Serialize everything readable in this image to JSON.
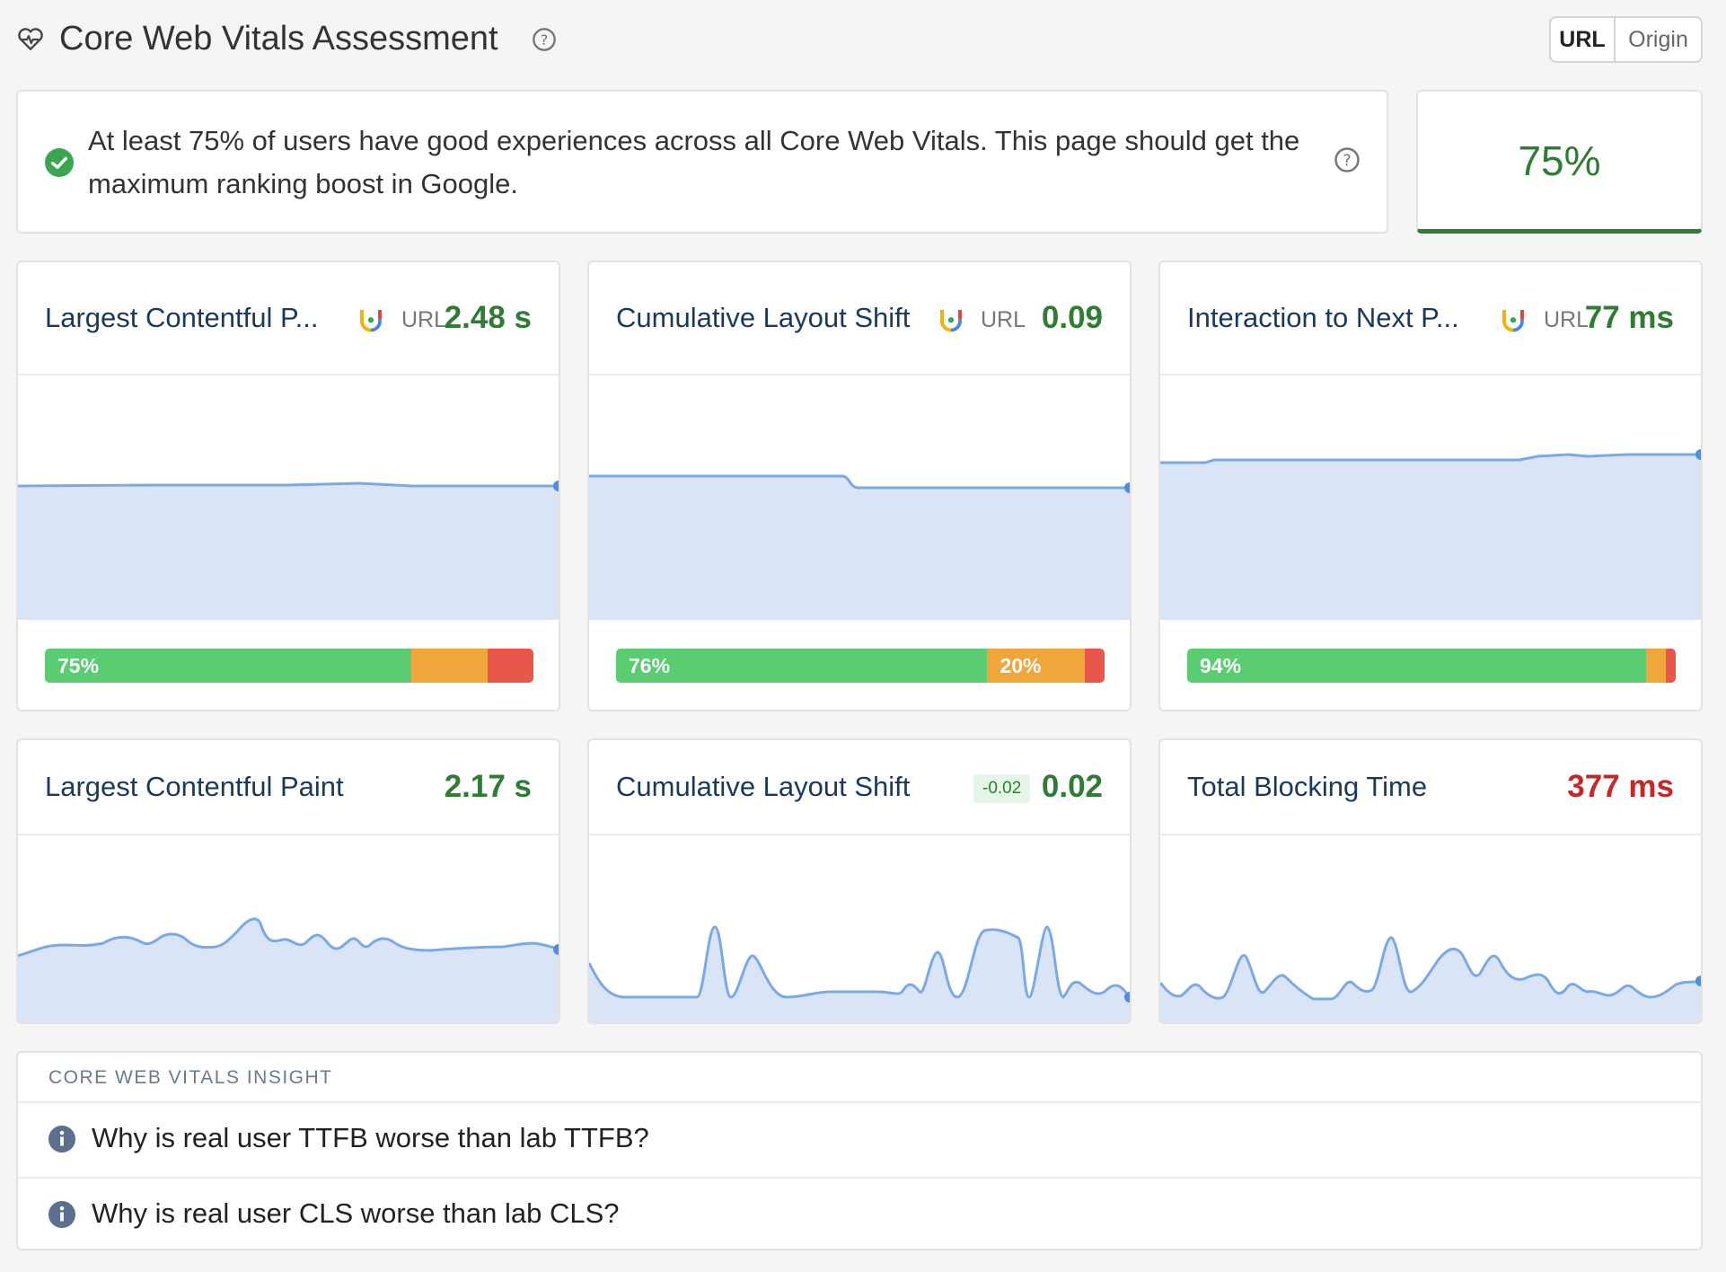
{
  "header": {
    "title": "Core Web Vitals Assessment",
    "toggle": [
      "URL",
      "Origin"
    ]
  },
  "assessment": {
    "message_line1": "At least 75% of users have good experiences across all Core Web Vitals. This page should get the",
    "message_line2": "maximum ranking boost in Google.",
    "score": "75%"
  },
  "field_cards": [
    {
      "title": "Largest Contentful P...",
      "source": "URL",
      "value": "2.48 s",
      "dist": [
        75,
        15.7,
        9.3
      ],
      "dist_labels": [
        "75%",
        "",
        ""
      ]
    },
    {
      "title": "Cumulative Layout Shift",
      "source": "URL",
      "value": "0.09",
      "dist": [
        76,
        20,
        4
      ],
      "dist_labels": [
        "76%",
        "20%",
        ""
      ]
    },
    {
      "title": "Interaction to Next P...",
      "source": "URL",
      "value": "77 ms",
      "dist": [
        94,
        4,
        2
      ],
      "dist_labels": [
        "94%",
        "",
        ""
      ]
    }
  ],
  "lab_cards": [
    {
      "title": "Largest Contentful Paint",
      "value": "2.17 s"
    },
    {
      "title": "Cumulative Layout Shift",
      "delta": "-0.02",
      "value": "0.02"
    },
    {
      "title": "Total Blocking Time",
      "value": "377 ms"
    }
  ],
  "insight": {
    "label": "CORE WEB VITALS INSIGHT",
    "items": [
      "Why is real user TTFB worse than lab TTFB?",
      "Why is real user CLS worse than lab CLS?"
    ]
  },
  "colors": {
    "good": "#2e7d32",
    "poor": "#c62828",
    "chart_fill": "#d9e5f7",
    "chart_line": "#7aa9e6"
  },
  "icons": [
    "heartbeat-icon",
    "help-icon",
    "check-circle-icon",
    "crux-logo-icon",
    "info-icon"
  ]
}
